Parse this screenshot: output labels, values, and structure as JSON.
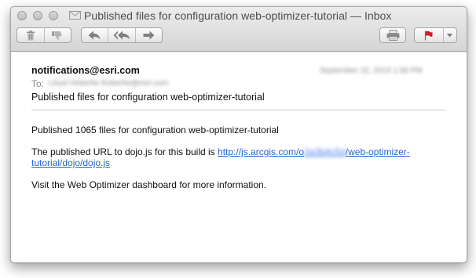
{
  "window": {
    "title": "Published files for configuration web-optimizer-tutorial — Inbox"
  },
  "toolbar": {
    "buttons": [
      "delete-icon",
      "junk-icon",
      "reply-icon",
      "reply-all-icon",
      "forward-icon",
      "print-icon",
      "flag-icon",
      "chevron-down-icon"
    ],
    "flag_color": "#d01c24"
  },
  "message": {
    "from": "notifications@esri.com",
    "date": "September 22, 2013  1:58 PM",
    "to_label": "To:",
    "to": "Lloyd Heberlie  lheberlie@esri.com",
    "subject": "Published files for configuration web-optimizer-tutorial",
    "body": {
      "line1": "Published 1065 files for configuration web-optimizer-tutorial",
      "line2_prefix": "The published URL to dojo.js for this build is ",
      "link_part1": "http://js.arcgis.com/o",
      "link_redacted": "2a3b4c5d",
      "link_part2": "/web-optimizer-",
      "link_line2": "tutorial/dojo/dojo.js",
      "line3": "Visit the Web Optimizer dashboard for more information."
    }
  }
}
